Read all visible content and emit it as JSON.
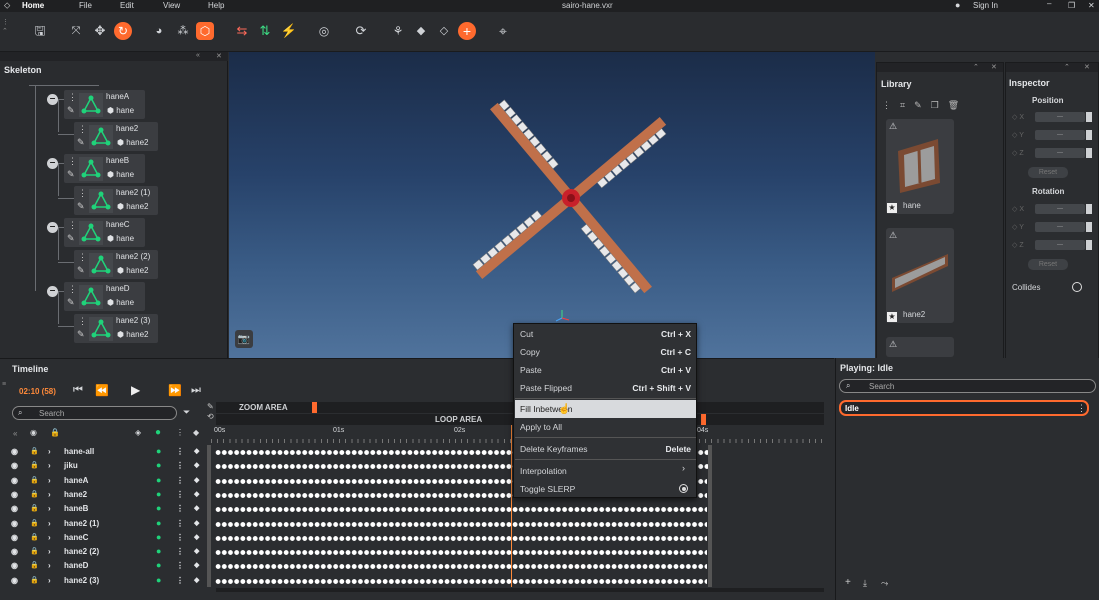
{
  "menubar": {
    "home": "Home",
    "file": "File",
    "edit": "Edit",
    "view": "View",
    "help": "Help",
    "document_title": "sairo-hane.vxr",
    "sign_in": "Sign In"
  },
  "toolbar": {
    "icons": [
      "save-icon",
      "fit-icon",
      "move-icon",
      "refresh-icon",
      "bone-icon",
      "nodes-icon",
      "cube-icon",
      "flip-x-icon",
      "flip-y-icon",
      "wand-icon",
      "globe-icon",
      "rotate-icon",
      "hierarchy-icon",
      "box-icon",
      "box-outline-icon",
      "add-icon",
      "target-icon"
    ]
  },
  "skeleton": {
    "title": "Skeleton",
    "nodes": [
      {
        "name": "haneA",
        "mesh": "hane"
      },
      {
        "name": "hane2",
        "mesh": "hane2"
      },
      {
        "name": "haneB",
        "mesh": "hane"
      },
      {
        "name": "hane2 (1)",
        "mesh": "hane2"
      },
      {
        "name": "haneC",
        "mesh": "hane"
      },
      {
        "name": "hane2 (2)",
        "mesh": "hane2"
      },
      {
        "name": "haneD",
        "mesh": "hane"
      },
      {
        "name": "hane2 (3)",
        "mesh": "hane2"
      }
    ]
  },
  "library": {
    "title": "Library",
    "items": [
      {
        "label": "hane"
      },
      {
        "label": "hane2"
      }
    ]
  },
  "inspector": {
    "title": "Inspector",
    "position_label": "Position",
    "rotation_label": "Rotation",
    "axes": [
      "X",
      "Y",
      "Z"
    ],
    "field_value": "---",
    "reset_label": "Reset",
    "collides_label": "Collides"
  },
  "timeline": {
    "title": "Timeline",
    "time": "02:10 (58)",
    "search_placeholder": "Search",
    "zoom_area": "ZOOM AREA",
    "loop_area": "LOOP AREA",
    "ticks": [
      "00s",
      "01s",
      "02s",
      "04s"
    ],
    "tracks": [
      "hane-all",
      "jiku",
      "haneA",
      "hane2",
      "haneB",
      "hane2 (1)",
      "haneC",
      "hane2 (2)",
      "haneD",
      "hane2 (3)"
    ]
  },
  "context_menu": {
    "items": [
      {
        "label": "Cut",
        "shortcut": "Ctrl + X"
      },
      {
        "label": "Copy",
        "shortcut": "Ctrl + C"
      },
      {
        "label": "Paste",
        "shortcut": "Ctrl + V"
      },
      {
        "label": "Paste Flipped",
        "shortcut": "Ctrl + Shift + V"
      },
      {
        "label": "Fill Inbetween",
        "shortcut": ""
      },
      {
        "label": "Apply to All",
        "shortcut": ""
      },
      {
        "label": "Delete Keyframes",
        "shortcut": "Delete"
      },
      {
        "label": "Interpolation",
        "shortcut": ""
      },
      {
        "label": "Toggle SLERP",
        "shortcut": ""
      }
    ]
  },
  "playing": {
    "title": "Playing: Idle",
    "search_placeholder": "Search",
    "animations": [
      {
        "name": "Idle"
      }
    ]
  },
  "colors": {
    "accent": "#ff6a2e",
    "node_green": "#1fd37a",
    "bg": "#2b2d30"
  }
}
